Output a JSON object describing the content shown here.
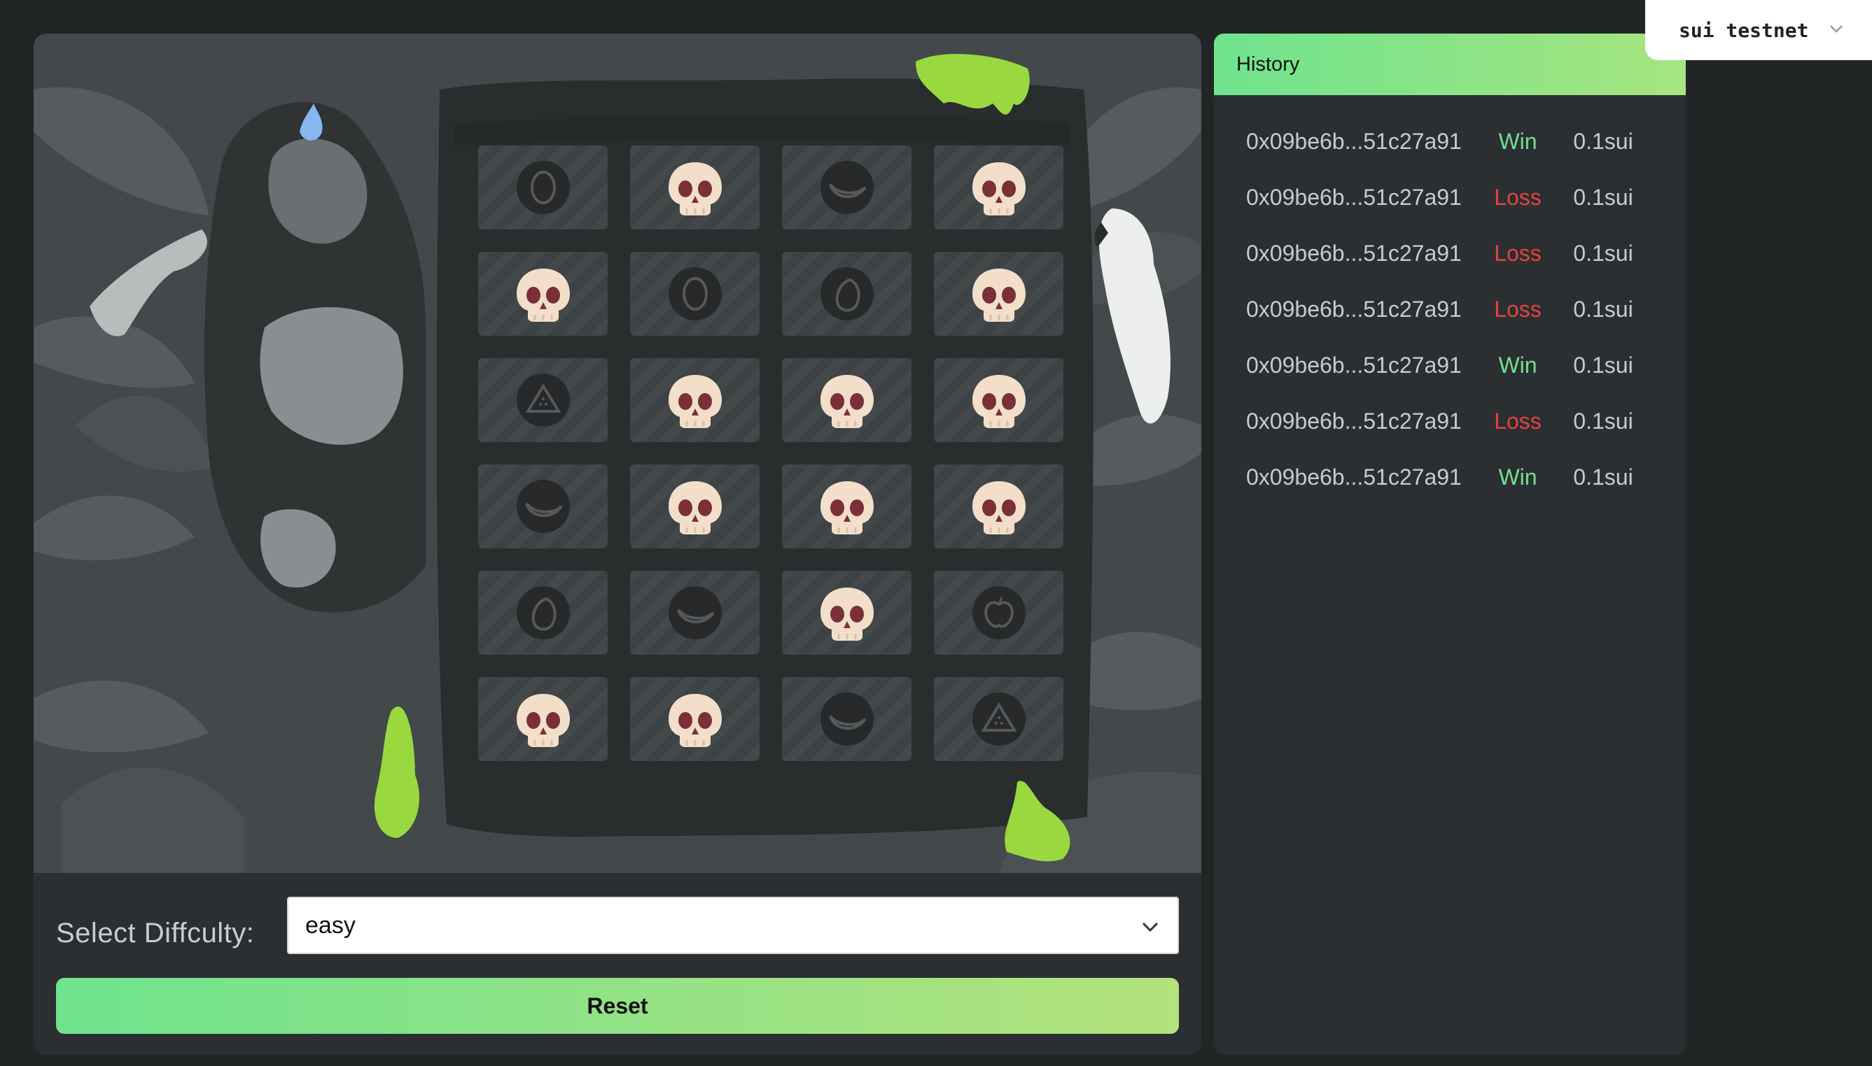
{
  "network": {
    "label": "sui testnet",
    "icon": "chevron-down-icon"
  },
  "game": {
    "grid": [
      [
        "coin",
        "skull",
        "banana",
        "skull"
      ],
      [
        "skull",
        "coin",
        "mango",
        "skull"
      ],
      [
        "watermelon",
        "skull",
        "skull",
        "skull"
      ],
      [
        "banana",
        "skull",
        "skull",
        "skull"
      ],
      [
        "mango",
        "banana",
        "skull",
        "apple"
      ],
      [
        "skull",
        "skull",
        "banana",
        "watermelon"
      ]
    ],
    "difficulty_label": "Select Diffculty:",
    "difficulty_value": "easy",
    "reset_label": "Reset"
  },
  "history": {
    "title": "History",
    "rows": [
      {
        "address": "0x09be6b...51c27a91",
        "result": "Win",
        "amount": "0.1sui"
      },
      {
        "address": "0x09be6b...51c27a91",
        "result": "Loss",
        "amount": "0.1sui"
      },
      {
        "address": "0x09be6b...51c27a91",
        "result": "Loss",
        "amount": "0.1sui"
      },
      {
        "address": "0x09be6b...51c27a91",
        "result": "Loss",
        "amount": "0.1sui"
      },
      {
        "address": "0x09be6b...51c27a91",
        "result": "Win",
        "amount": "0.1sui"
      },
      {
        "address": "0x09be6b...51c27a91",
        "result": "Loss",
        "amount": "0.1sui"
      },
      {
        "address": "0x09be6b...51c27a91",
        "result": "Win",
        "amount": "0.1sui"
      }
    ]
  },
  "colors": {
    "accent_green": "#6fe38e",
    "win": "#74e08e",
    "loss": "#e0453e",
    "background": "#222526"
  }
}
